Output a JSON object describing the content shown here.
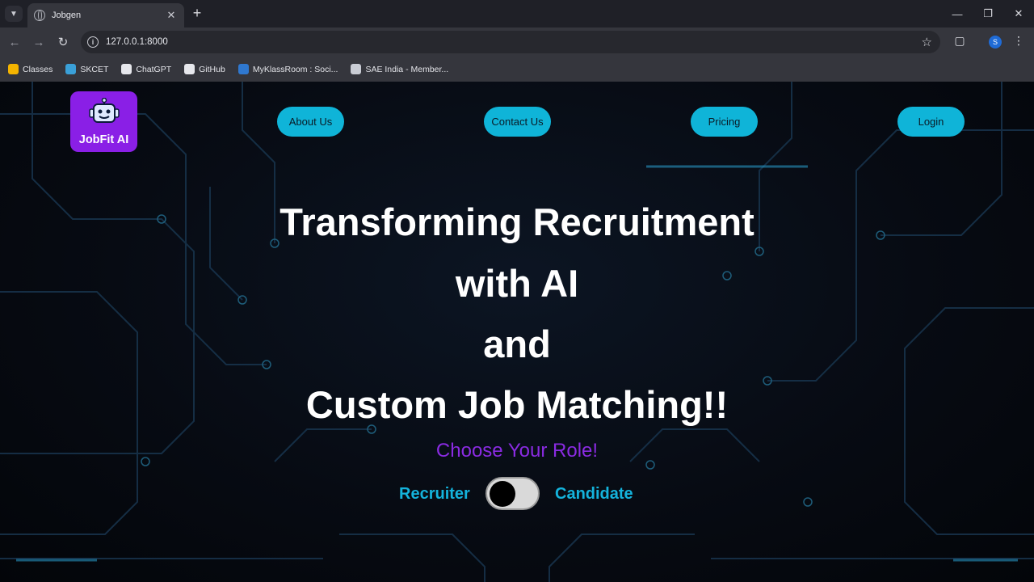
{
  "browser": {
    "tab_title": "Jobgen",
    "url": "127.0.0.1:8000",
    "profile_initial": "S",
    "bookmarks": [
      {
        "label": "Classes",
        "color": "#f4b400"
      },
      {
        "label": "SKCET",
        "color": "#3aa0d8"
      },
      {
        "label": "ChatGPT",
        "color": "#e6e7ec"
      },
      {
        "label": "GitHub",
        "color": "#e6e7ec"
      },
      {
        "label": "MyKlassRoom : Soci...",
        "color": "#2f78d0"
      },
      {
        "label": "SAE India - Member...",
        "color": "#c9ccd4"
      }
    ]
  },
  "nav": {
    "logo_text": "JobFit AI",
    "about": "About Us",
    "contact": "Contact Us",
    "pricing": "Pricing",
    "login": "Login"
  },
  "hero": {
    "line1": "Transforming Recruitment",
    "line2": "with AI",
    "line3": "and",
    "line4": "Custom Job Matching!!"
  },
  "role": {
    "prompt": "Choose Your Role!",
    "left_label": "Recruiter",
    "right_label": "Candidate"
  },
  "colors": {
    "accent_cyan": "#0fb4d8",
    "logo_purple": "#8a1fe6",
    "prompt_purple": "#8a2be2"
  }
}
